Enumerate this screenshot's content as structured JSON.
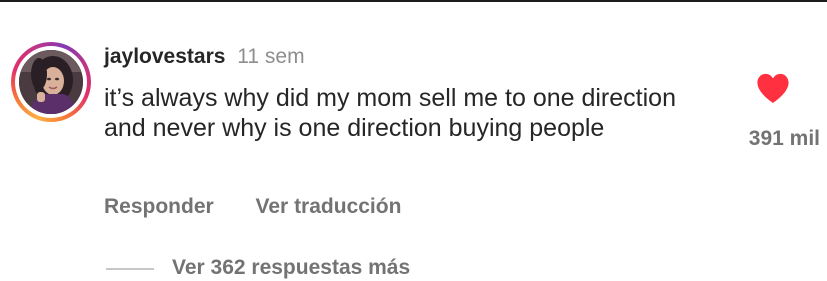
{
  "comment": {
    "username": "jaylovestars",
    "time": "11 sem",
    "text": "it’s always why did my mom sell me to one direction and never why is one direction buying people",
    "reply_label": "Responder",
    "translate_label": "Ver traducción",
    "likes": "391 mil",
    "liked": true,
    "like_icon": "heart-icon",
    "like_color": "#ff3040",
    "view_replies_label": "Ver 362 respuestas más"
  },
  "colors": {
    "text": "#262626",
    "secondary_text": "#737373",
    "story_ring": [
      "#fcaf45",
      "#f77737",
      "#e1306c",
      "#c13584",
      "#833ab4"
    ]
  }
}
